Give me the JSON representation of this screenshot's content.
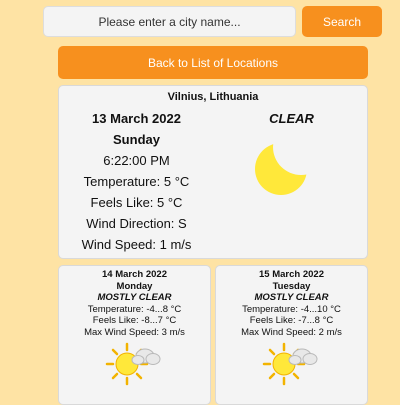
{
  "search": {
    "placeholder": "Please enter a city name...",
    "button_label": "Search"
  },
  "back_label": "Back to List of Locations",
  "current": {
    "location": "Vilnius, Lithuania",
    "date": "13 March 2022",
    "day": "Sunday",
    "time": "6:22:00 PM",
    "temperature": "Temperature: 5 °C",
    "feels_like": "Feels Like: 5 °C",
    "wind_direction": "Wind Direction: S",
    "wind_speed": "Wind Speed: 1 m/s",
    "condition": "CLEAR",
    "icon": "moon-icon"
  },
  "forecast": [
    {
      "date": "14 March 2022",
      "day": "Monday",
      "condition": "MOSTLY CLEAR",
      "temperature": "Temperature: -4...8 °C",
      "feels_like": "Feels Like: -8...7 °C",
      "wind": "Max Wind Speed: 3 m/s",
      "icon": "partly-cloudy-sun-icon"
    },
    {
      "date": "15 March 2022",
      "day": "Tuesday",
      "condition": "MOSTLY CLEAR",
      "temperature": "Temperature: -4...10 °C",
      "feels_like": "Feels Like: -7...8 °C",
      "wind": "Max Wind Speed: 2 m/s",
      "icon": "partly-cloudy-sun-icon"
    }
  ],
  "colors": {
    "background": "#fee3a4",
    "accent": "#f7901e",
    "card": "#f4f4f4",
    "sun": "#ffe83a"
  }
}
